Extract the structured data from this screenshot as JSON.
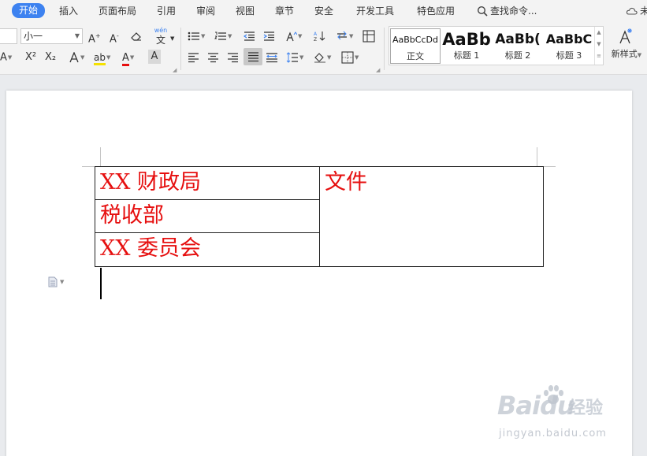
{
  "menu": {
    "items": [
      {
        "id": "home",
        "label": "开始",
        "active": true
      },
      {
        "id": "insert",
        "label": "插入"
      },
      {
        "id": "layout",
        "label": "页面布局"
      },
      {
        "id": "references",
        "label": "引用"
      },
      {
        "id": "review",
        "label": "审阅"
      },
      {
        "id": "view",
        "label": "视图"
      },
      {
        "id": "chapter",
        "label": "章节"
      },
      {
        "id": "security",
        "label": "安全"
      },
      {
        "id": "developer",
        "label": "开发工具"
      },
      {
        "id": "special",
        "label": "特色应用"
      }
    ],
    "search_label": "查找命令...",
    "cut_off_label": "未"
  },
  "ribbon": {
    "font_size_value": "小一",
    "phonetic_label": "文",
    "phonetic_superscript": "wén",
    "grow_font": "A",
    "shrink_font": "A",
    "superscript_label": "X²",
    "subscript_label": "X₂",
    "highlight_label": "ab",
    "font_color_label": "A",
    "char_shading_label": "A",
    "effect_label": "A",
    "styles": [
      {
        "sample": "AaBbCcDd",
        "name": "正文"
      },
      {
        "sample": "AaBb",
        "name": "标题 1"
      },
      {
        "sample": "AaBb(",
        "name": "标题 2"
      },
      {
        "sample": "AaBbC",
        "name": "标题 3"
      }
    ],
    "new_style_label": "新样式",
    "colors": {
      "highlight": "#f5e100",
      "font_color": "#e60f0f"
    }
  },
  "document": {
    "table": {
      "left_cells": [
        "XX 财政局",
        "税收部",
        "XX 委员会"
      ],
      "right_cell": "文件"
    },
    "text_color": "#e60f0f"
  },
  "watermark": {
    "logo": "Baidu",
    "brand_cn": "经验",
    "url": "jingyan.baidu.com"
  }
}
